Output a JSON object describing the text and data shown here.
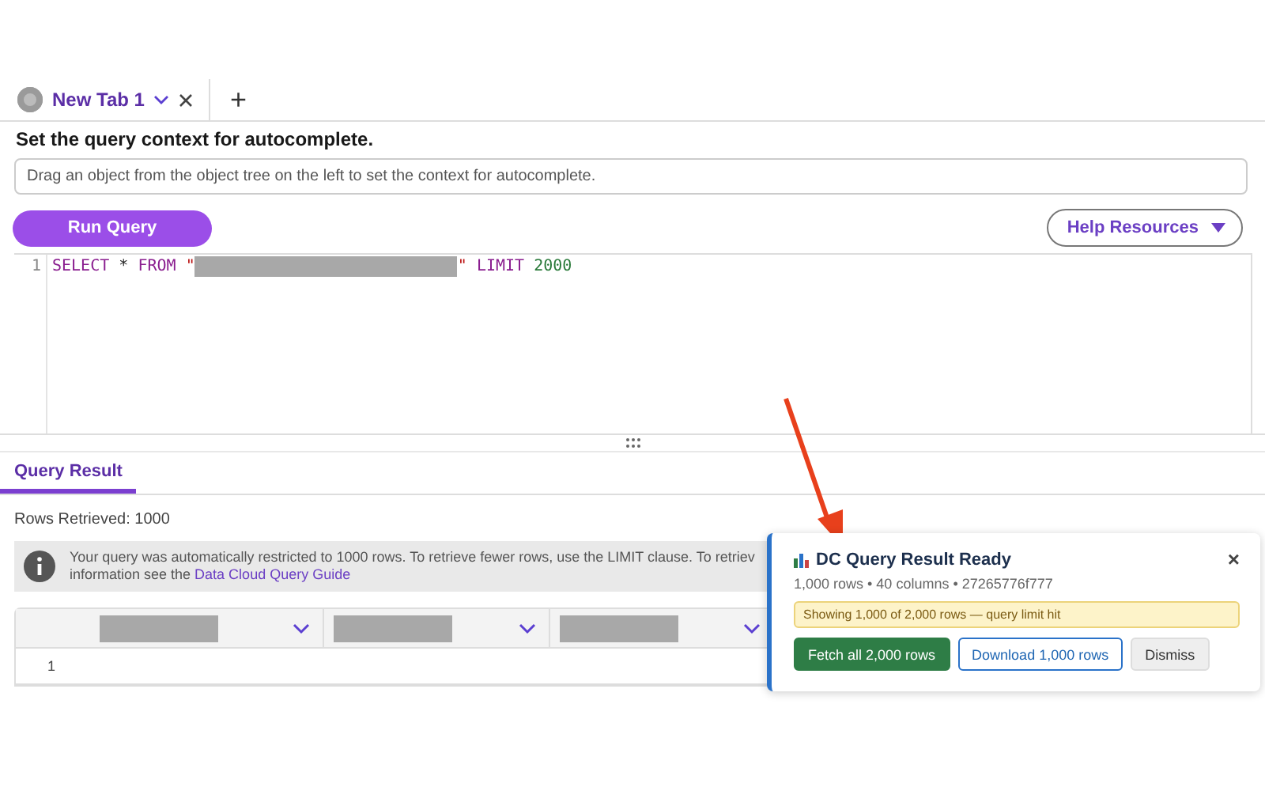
{
  "tabs": [
    {
      "label": "New Tab 1",
      "selected": true
    }
  ],
  "context": {
    "heading": "Set the query context for autocomplete.",
    "placeholder": "Drag an object from the object tree on the left to set the context for autocomplete."
  },
  "new_tab_button": "+",
  "run_button": "Run Query",
  "help_button": "Help Resources",
  "editor": {
    "line_numbers": [
      "1"
    ],
    "tokens": [
      {
        "kind": "keyword",
        "text": "SELECT"
      },
      {
        "kind": "plain",
        "text": "*"
      },
      {
        "kind": "keyword",
        "text": "FROM"
      },
      {
        "kind": "string",
        "text": "\""
      },
      {
        "kind": "redacted"
      },
      {
        "kind": "string",
        "text": "\""
      },
      {
        "kind": "keyword",
        "text": "LIMIT"
      },
      {
        "kind": "number",
        "text": "2000"
      }
    ]
  },
  "result_tabs": [
    {
      "label": "Query Result",
      "selected": true
    }
  ],
  "rows_retrieved": "Rows Retrieved: 1000",
  "notice": {
    "line_1": "Your query was automatically restricted to 1000 rows. To retrieve fewer rows, use the LIMIT clause. To retriev",
    "line_2": "information see the ",
    "link": "Data Cloud Query Guide"
  },
  "table": {
    "columns": [
      {
        "sortable": true
      },
      {
        "sortable": true
      },
      {
        "sortable": true
      }
    ],
    "rows": [
      {
        "row_number": "1"
      }
    ]
  },
  "popup": {
    "title": "DC Query Result Ready",
    "close": "×",
    "meta": "1,000 rows • 40 columns • 27265776f777",
    "warning": "Showing 1,000 of 2,000 rows — query limit hit",
    "buttons": [
      {
        "label": "Fetch all 2,000 rows",
        "kind": "primary"
      },
      {
        "label": "Download 1,000 rows",
        "kind": "outline"
      },
      {
        "label": "Dismiss",
        "kind": "neutral"
      }
    ]
  }
}
